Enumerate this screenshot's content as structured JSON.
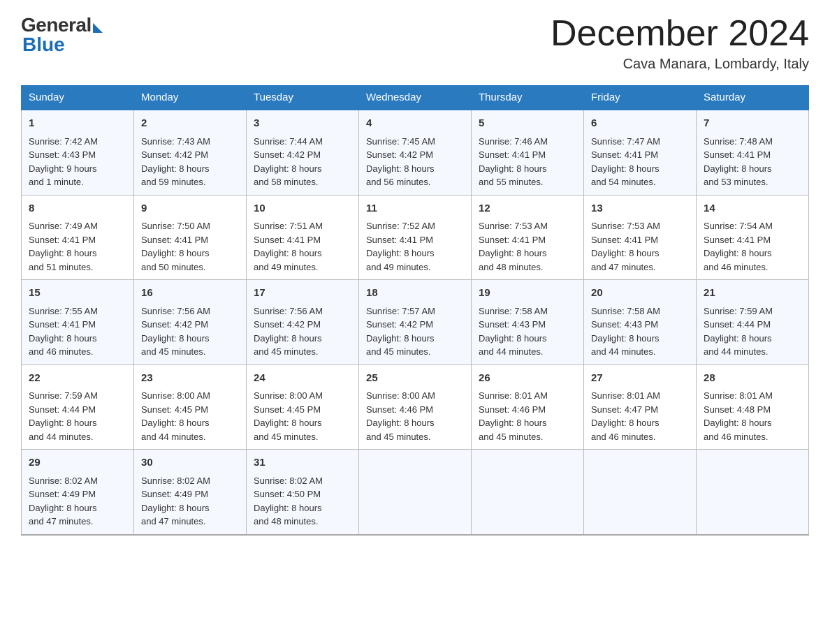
{
  "header": {
    "logo_general": "General",
    "logo_blue": "Blue",
    "month_title": "December 2024",
    "location": "Cava Manara, Lombardy, Italy"
  },
  "days_of_week": [
    "Sunday",
    "Monday",
    "Tuesday",
    "Wednesday",
    "Thursday",
    "Friday",
    "Saturday"
  ],
  "weeks": [
    [
      {
        "day": "1",
        "sunrise": "7:42 AM",
        "sunset": "4:43 PM",
        "daylight": "9 hours and 1 minute."
      },
      {
        "day": "2",
        "sunrise": "7:43 AM",
        "sunset": "4:42 PM",
        "daylight": "8 hours and 59 minutes."
      },
      {
        "day": "3",
        "sunrise": "7:44 AM",
        "sunset": "4:42 PM",
        "daylight": "8 hours and 58 minutes."
      },
      {
        "day": "4",
        "sunrise": "7:45 AM",
        "sunset": "4:42 PM",
        "daylight": "8 hours and 56 minutes."
      },
      {
        "day": "5",
        "sunrise": "7:46 AM",
        "sunset": "4:41 PM",
        "daylight": "8 hours and 55 minutes."
      },
      {
        "day": "6",
        "sunrise": "7:47 AM",
        "sunset": "4:41 PM",
        "daylight": "8 hours and 54 minutes."
      },
      {
        "day": "7",
        "sunrise": "7:48 AM",
        "sunset": "4:41 PM",
        "daylight": "8 hours and 53 minutes."
      }
    ],
    [
      {
        "day": "8",
        "sunrise": "7:49 AM",
        "sunset": "4:41 PM",
        "daylight": "8 hours and 51 minutes."
      },
      {
        "day": "9",
        "sunrise": "7:50 AM",
        "sunset": "4:41 PM",
        "daylight": "8 hours and 50 minutes."
      },
      {
        "day": "10",
        "sunrise": "7:51 AM",
        "sunset": "4:41 PM",
        "daylight": "8 hours and 49 minutes."
      },
      {
        "day": "11",
        "sunrise": "7:52 AM",
        "sunset": "4:41 PM",
        "daylight": "8 hours and 49 minutes."
      },
      {
        "day": "12",
        "sunrise": "7:53 AM",
        "sunset": "4:41 PM",
        "daylight": "8 hours and 48 minutes."
      },
      {
        "day": "13",
        "sunrise": "7:53 AM",
        "sunset": "4:41 PM",
        "daylight": "8 hours and 47 minutes."
      },
      {
        "day": "14",
        "sunrise": "7:54 AM",
        "sunset": "4:41 PM",
        "daylight": "8 hours and 46 minutes."
      }
    ],
    [
      {
        "day": "15",
        "sunrise": "7:55 AM",
        "sunset": "4:41 PM",
        "daylight": "8 hours and 46 minutes."
      },
      {
        "day": "16",
        "sunrise": "7:56 AM",
        "sunset": "4:42 PM",
        "daylight": "8 hours and 45 minutes."
      },
      {
        "day": "17",
        "sunrise": "7:56 AM",
        "sunset": "4:42 PM",
        "daylight": "8 hours and 45 minutes."
      },
      {
        "day": "18",
        "sunrise": "7:57 AM",
        "sunset": "4:42 PM",
        "daylight": "8 hours and 45 minutes."
      },
      {
        "day": "19",
        "sunrise": "7:58 AM",
        "sunset": "4:43 PM",
        "daylight": "8 hours and 44 minutes."
      },
      {
        "day": "20",
        "sunrise": "7:58 AM",
        "sunset": "4:43 PM",
        "daylight": "8 hours and 44 minutes."
      },
      {
        "day": "21",
        "sunrise": "7:59 AM",
        "sunset": "4:44 PM",
        "daylight": "8 hours and 44 minutes."
      }
    ],
    [
      {
        "day": "22",
        "sunrise": "7:59 AM",
        "sunset": "4:44 PM",
        "daylight": "8 hours and 44 minutes."
      },
      {
        "day": "23",
        "sunrise": "8:00 AM",
        "sunset": "4:45 PM",
        "daylight": "8 hours and 44 minutes."
      },
      {
        "day": "24",
        "sunrise": "8:00 AM",
        "sunset": "4:45 PM",
        "daylight": "8 hours and 45 minutes."
      },
      {
        "day": "25",
        "sunrise": "8:00 AM",
        "sunset": "4:46 PM",
        "daylight": "8 hours and 45 minutes."
      },
      {
        "day": "26",
        "sunrise": "8:01 AM",
        "sunset": "4:46 PM",
        "daylight": "8 hours and 45 minutes."
      },
      {
        "day": "27",
        "sunrise": "8:01 AM",
        "sunset": "4:47 PM",
        "daylight": "8 hours and 46 minutes."
      },
      {
        "day": "28",
        "sunrise": "8:01 AM",
        "sunset": "4:48 PM",
        "daylight": "8 hours and 46 minutes."
      }
    ],
    [
      {
        "day": "29",
        "sunrise": "8:02 AM",
        "sunset": "4:49 PM",
        "daylight": "8 hours and 47 minutes."
      },
      {
        "day": "30",
        "sunrise": "8:02 AM",
        "sunset": "4:49 PM",
        "daylight": "8 hours and 47 minutes."
      },
      {
        "day": "31",
        "sunrise": "8:02 AM",
        "sunset": "4:50 PM",
        "daylight": "8 hours and 48 minutes."
      },
      {
        "day": "",
        "sunrise": "",
        "sunset": "",
        "daylight": ""
      },
      {
        "day": "",
        "sunrise": "",
        "sunset": "",
        "daylight": ""
      },
      {
        "day": "",
        "sunrise": "",
        "sunset": "",
        "daylight": ""
      },
      {
        "day": "",
        "sunrise": "",
        "sunset": "",
        "daylight": ""
      }
    ]
  ],
  "labels": {
    "sunrise": "Sunrise:",
    "sunset": "Sunset:",
    "daylight": "Daylight:"
  }
}
